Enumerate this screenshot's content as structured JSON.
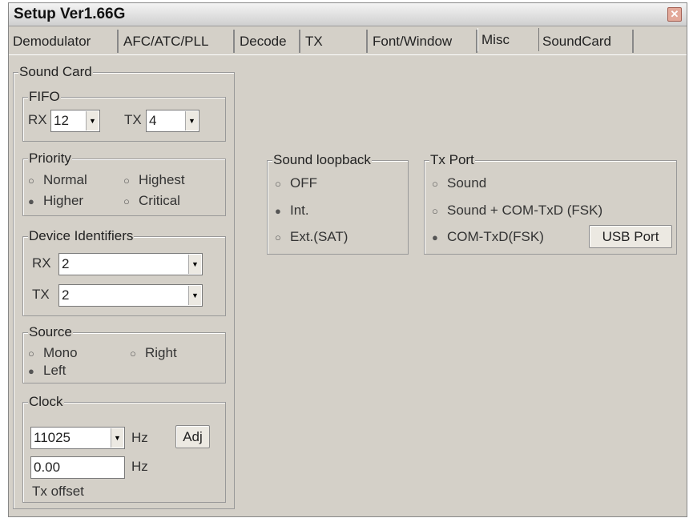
{
  "window": {
    "title": "Setup Ver1.66G"
  },
  "tabs": [
    {
      "label": "Demodulator"
    },
    {
      "label": "AFC/ATC/PLL"
    },
    {
      "label": "Decode"
    },
    {
      "label": "TX"
    },
    {
      "label": "Font/Window"
    },
    {
      "label": "Misc",
      "selected": true
    },
    {
      "label": "SoundCard"
    }
  ],
  "sound_card": {
    "title": "Sound Card",
    "fifo": {
      "title": "FIFO",
      "rx_label": "RX",
      "rx_value": "12",
      "tx_label": "TX",
      "tx_value": "4"
    },
    "priority": {
      "title": "Priority",
      "options": [
        "Normal",
        "Highest",
        "Higher",
        "Critical"
      ],
      "selected": "Higher"
    },
    "device_identifiers": {
      "title": "Device Identifiers",
      "rx_label": "RX",
      "rx_value": "2",
      "tx_label": "TX",
      "tx_value": "2"
    },
    "source": {
      "title": "Source",
      "options": [
        "Mono",
        "Right",
        "Left"
      ],
      "selected": "Left"
    },
    "clock": {
      "title": "Clock",
      "rate_value": "11025",
      "rate_unit": "Hz",
      "adj_label": "Adj",
      "offset_value": "0.00",
      "offset_unit": "Hz",
      "offset_label": "Tx offset"
    }
  },
  "sound_loopback": {
    "title": "Sound loopback",
    "options": [
      "OFF",
      "Int.",
      "Ext.(SAT)"
    ],
    "selected": "Int."
  },
  "tx_port": {
    "title": "Tx Port",
    "options": [
      "Sound",
      "Sound + COM-TxD (FSK)",
      "COM-TxD(FSK)"
    ],
    "selected": "COM-TxD(FSK)",
    "usb_button": "USB Port"
  },
  "icons": {
    "close": "close-icon",
    "dropdown": "chevron-down-icon",
    "radio": "radio-icon"
  }
}
